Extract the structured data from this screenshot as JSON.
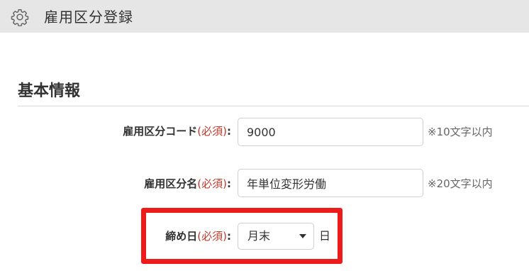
{
  "header": {
    "title": "雇用区分登録",
    "icon": "gear-icon"
  },
  "section": {
    "title": "基本情報"
  },
  "form": {
    "code": {
      "label": "雇用区分コード",
      "required": "(必須)",
      "colon": ":",
      "value": "9000",
      "hint": "※10文字以内"
    },
    "name": {
      "label": "雇用区分名",
      "required": "(必須)",
      "colon": ":",
      "value": "年単位変形労働",
      "hint": "※20文字以内"
    },
    "closing_day": {
      "label": "締め日",
      "required": "(必須)",
      "colon": ":",
      "selected": "月末",
      "unit": "日"
    }
  },
  "colors": {
    "header_bg": "#e6e6e6",
    "required": "#c0392b",
    "highlight": "#ee1b1b"
  }
}
